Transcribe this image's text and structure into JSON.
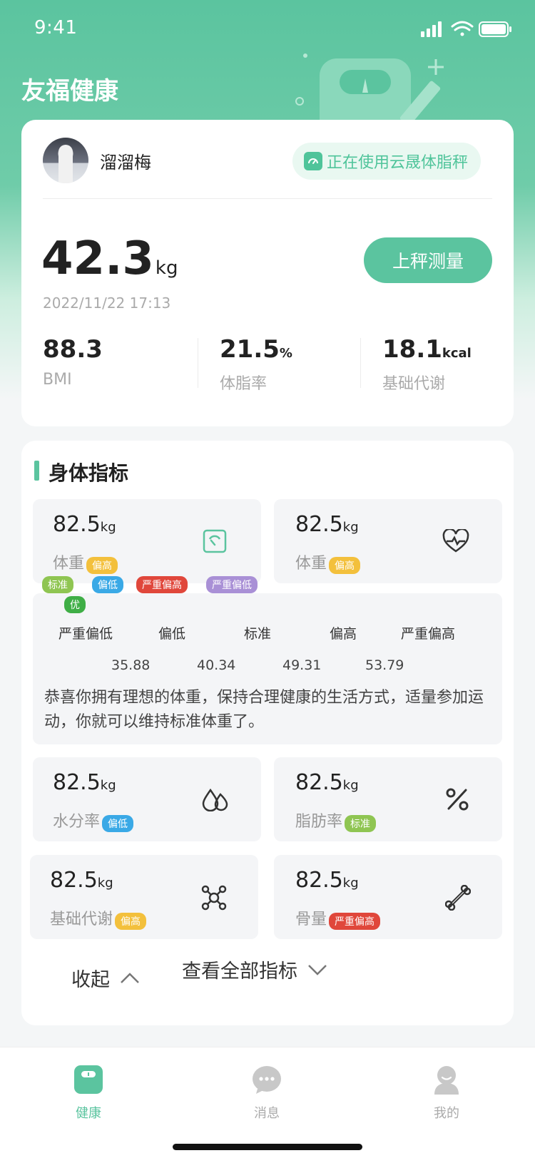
{
  "status_bar": {
    "time": "9:41"
  },
  "app": {
    "title": "友福健康"
  },
  "profile": {
    "name": "溜溜梅",
    "device_status": "正在使用云晟体脂秤"
  },
  "weight": {
    "value": "42.3",
    "unit": "kg",
    "timestamp": "2022/11/22 17:13",
    "measure_button": "上秤测量"
  },
  "summary_metrics": [
    {
      "value": "88.3",
      "unit": "",
      "label": "BMI"
    },
    {
      "value": "21.5",
      "unit": "%",
      "label": "体脂率"
    },
    {
      "value": "18.1",
      "unit": "kcal",
      "label": "基础代谢"
    }
  ],
  "body_index": {
    "title": "身体指标",
    "tiles": [
      {
        "value": "82.5",
        "unit": "kg",
        "label": "体重",
        "badge": "偏高",
        "icon": "scale-icon"
      },
      {
        "value": "82.5",
        "unit": "kg",
        "label": "体重",
        "badge": "偏高",
        "icon": "heartbeat-icon"
      },
      {
        "value": "82.5",
        "unit": "kg",
        "label": "水分率",
        "badge": "偏低",
        "icon": "water-drops-icon"
      },
      {
        "value": "82.5",
        "unit": "kg",
        "label": "脂肪率",
        "badge": "标准",
        "icon": "percent-icon"
      },
      {
        "value": "82.5",
        "unit": "kg",
        "label": "基础代谢",
        "badge": "偏高",
        "icon": "molecule-icon"
      },
      {
        "value": "82.5",
        "unit": "kg",
        "label": "骨量",
        "badge": "严重偏高",
        "icon": "bone-icon"
      }
    ],
    "legend_badges": [
      "标准",
      "偏低",
      "严重偏高",
      "严重偏低",
      "优"
    ],
    "scale_levels": [
      "严重偏低",
      "偏低",
      "标准",
      "偏高",
      "严重偏高"
    ],
    "scale_thresholds": [
      "35.88",
      "40.34",
      "49.31",
      "53.79"
    ],
    "detail_text": "恭喜你拥有理想的体重，保持合理健康的生活方式，适量参加运动，你就可以维持标准体重了。",
    "view_all": "查看全部指标",
    "collapse": "收起"
  },
  "tabbar": {
    "items": [
      {
        "label": "健康",
        "icon": "scale-tab-icon",
        "active": true
      },
      {
        "label": "消息",
        "icon": "chat-bubble-icon",
        "active": false
      },
      {
        "label": "我的",
        "icon": "user-icon",
        "active": false
      }
    ]
  },
  "colors": {
    "brand": "#5bc49f",
    "badge_high": "#f3c03c",
    "badge_low": "#3aa9e6",
    "badge_standard": "#8fc552",
    "badge_very_high": "#e0473b",
    "badge_very_low": "#a990d6",
    "badge_good": "#3fae46"
  }
}
